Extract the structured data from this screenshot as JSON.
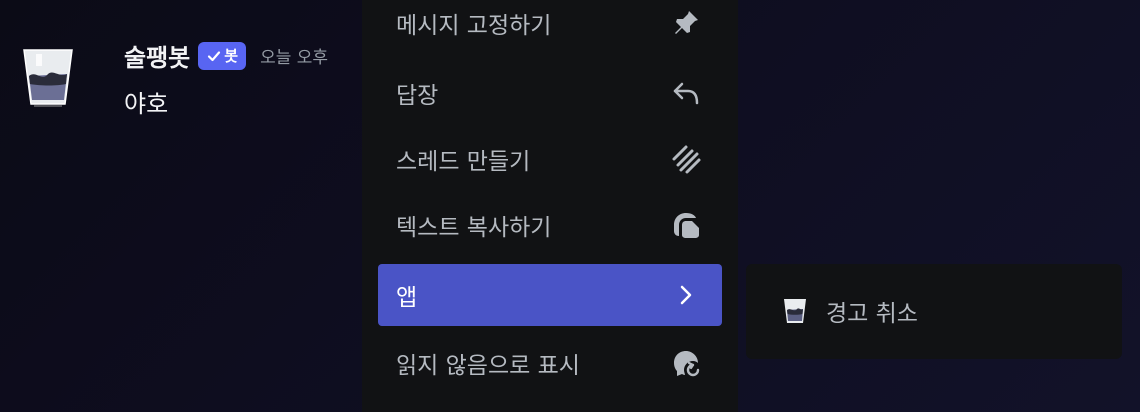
{
  "message": {
    "username": "술팽봇",
    "badge_label": "봇",
    "timestamp": "오늘 오후",
    "content": "야호"
  },
  "context_menu": {
    "items": [
      {
        "label": "메시지 고정하기",
        "icon": "pin-icon"
      },
      {
        "label": "답장",
        "icon": "reply-icon"
      },
      {
        "label": "스레드 만들기",
        "icon": "thread-icon"
      },
      {
        "label": "텍스트 복사하기",
        "icon": "copy-icon"
      },
      {
        "label": "앱",
        "icon": "chevron-right-icon",
        "active": true
      },
      {
        "label": "읽지 않음으로 표시",
        "icon": "mark-unread-icon"
      }
    ]
  },
  "submenu": {
    "items": [
      {
        "label": "경고 취소",
        "icon": "cup-app-icon"
      }
    ]
  },
  "colors": {
    "background": "#0e0d1f",
    "menu_bg": "#111214",
    "active_item": "#4a54c6",
    "badge": "#5865f2"
  }
}
